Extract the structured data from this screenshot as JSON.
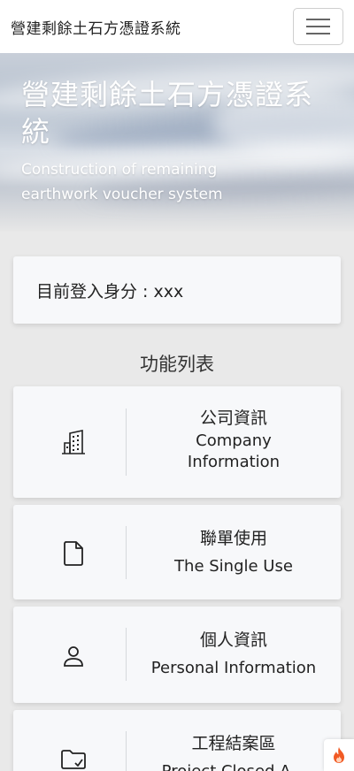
{
  "navbar": {
    "title": "營建剩餘土石方憑證系統",
    "menu_icon": "hamburger-icon"
  },
  "hero": {
    "title": "營建剩餘土石方憑證系統",
    "subtitle": "Construction of remaining earthwork voucher system"
  },
  "user": {
    "label": "目前登入身分 : xxx"
  },
  "functions": {
    "heading": "功能列表",
    "items": [
      {
        "icon": "building-icon",
        "zh": "公司資訊",
        "en": "Company Information"
      },
      {
        "icon": "file-icon",
        "zh": "聯單使用",
        "en": "The Single Use"
      },
      {
        "icon": "person-icon",
        "zh": "個人資訊",
        "en": "Personal Information"
      },
      {
        "icon": "folder-check-icon",
        "zh": "工程結案區",
        "en": "Project Closed A..."
      }
    ]
  },
  "floating": {
    "icon": "fire-icon",
    "color": "#f15a24"
  }
}
